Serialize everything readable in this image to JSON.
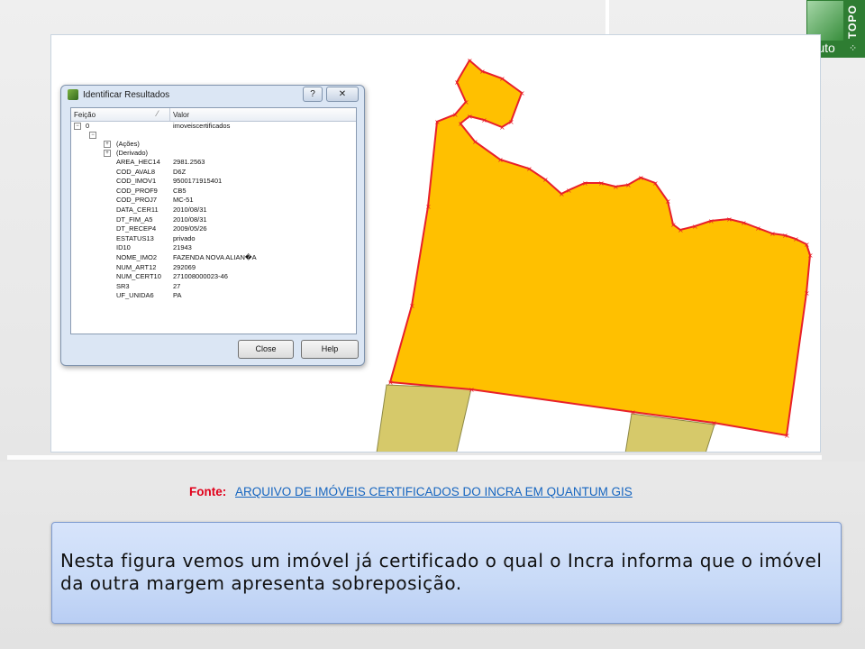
{
  "logo": {
    "word_auto": "Auto",
    "word_topo": "TOPO",
    "brand_color": "#2e7d32"
  },
  "dialog": {
    "title": "Identificar Resultados",
    "help_button": "?",
    "close_icon": "✕",
    "columns": {
      "feature": "Feição",
      "value": "Valor"
    },
    "root": {
      "key": "0",
      "value": "imoveiscertificados"
    },
    "groups": [
      "(Ações)",
      "(Derivado)"
    ],
    "attributes": [
      {
        "key": "AREA_HEC14",
        "value": "2981.2563"
      },
      {
        "key": "COD_AVAL8",
        "value": "D6Z"
      },
      {
        "key": "COD_IMOV1",
        "value": "9500171915401"
      },
      {
        "key": "COD_PROF9",
        "value": "CB5"
      },
      {
        "key": "COD_PROJ7",
        "value": "MC-51"
      },
      {
        "key": "DATA_CER11",
        "value": "2010/08/31"
      },
      {
        "key": "DT_FIM_A5",
        "value": "2010/08/31"
      },
      {
        "key": "DT_RECEP4",
        "value": "2009/05/26"
      },
      {
        "key": "ESTATUS13",
        "value": "privado"
      },
      {
        "key": "ID10",
        "value": "21943"
      },
      {
        "key": "NOME_IMO2",
        "value": "FAZENDA NOVA ALIAN�A"
      },
      {
        "key": "NUM_ART12",
        "value": "292069"
      },
      {
        "key": "NUM_CERT10",
        "value": "271008000023-46"
      },
      {
        "key": "SR3",
        "value": "27"
      },
      {
        "key": "UF_UNIDA6",
        "value": "PA"
      }
    ],
    "close_label": "Close",
    "help_label": "Help"
  },
  "map": {
    "polygon_fill": "#ffc000",
    "polygon_stroke": "#e8202a",
    "neighbor_fill": "#d6c96a"
  },
  "source": {
    "label": "Fonte:",
    "link_text": "ARQUIVO DE IMÓVEIS CERTIFICADOS DO INCRA EM QUANTUM GIS"
  },
  "note": {
    "text": "Nesta figura vemos um imóvel já certificado o qual o Incra informa que o imóvel da outra margem apresenta sobreposição."
  }
}
